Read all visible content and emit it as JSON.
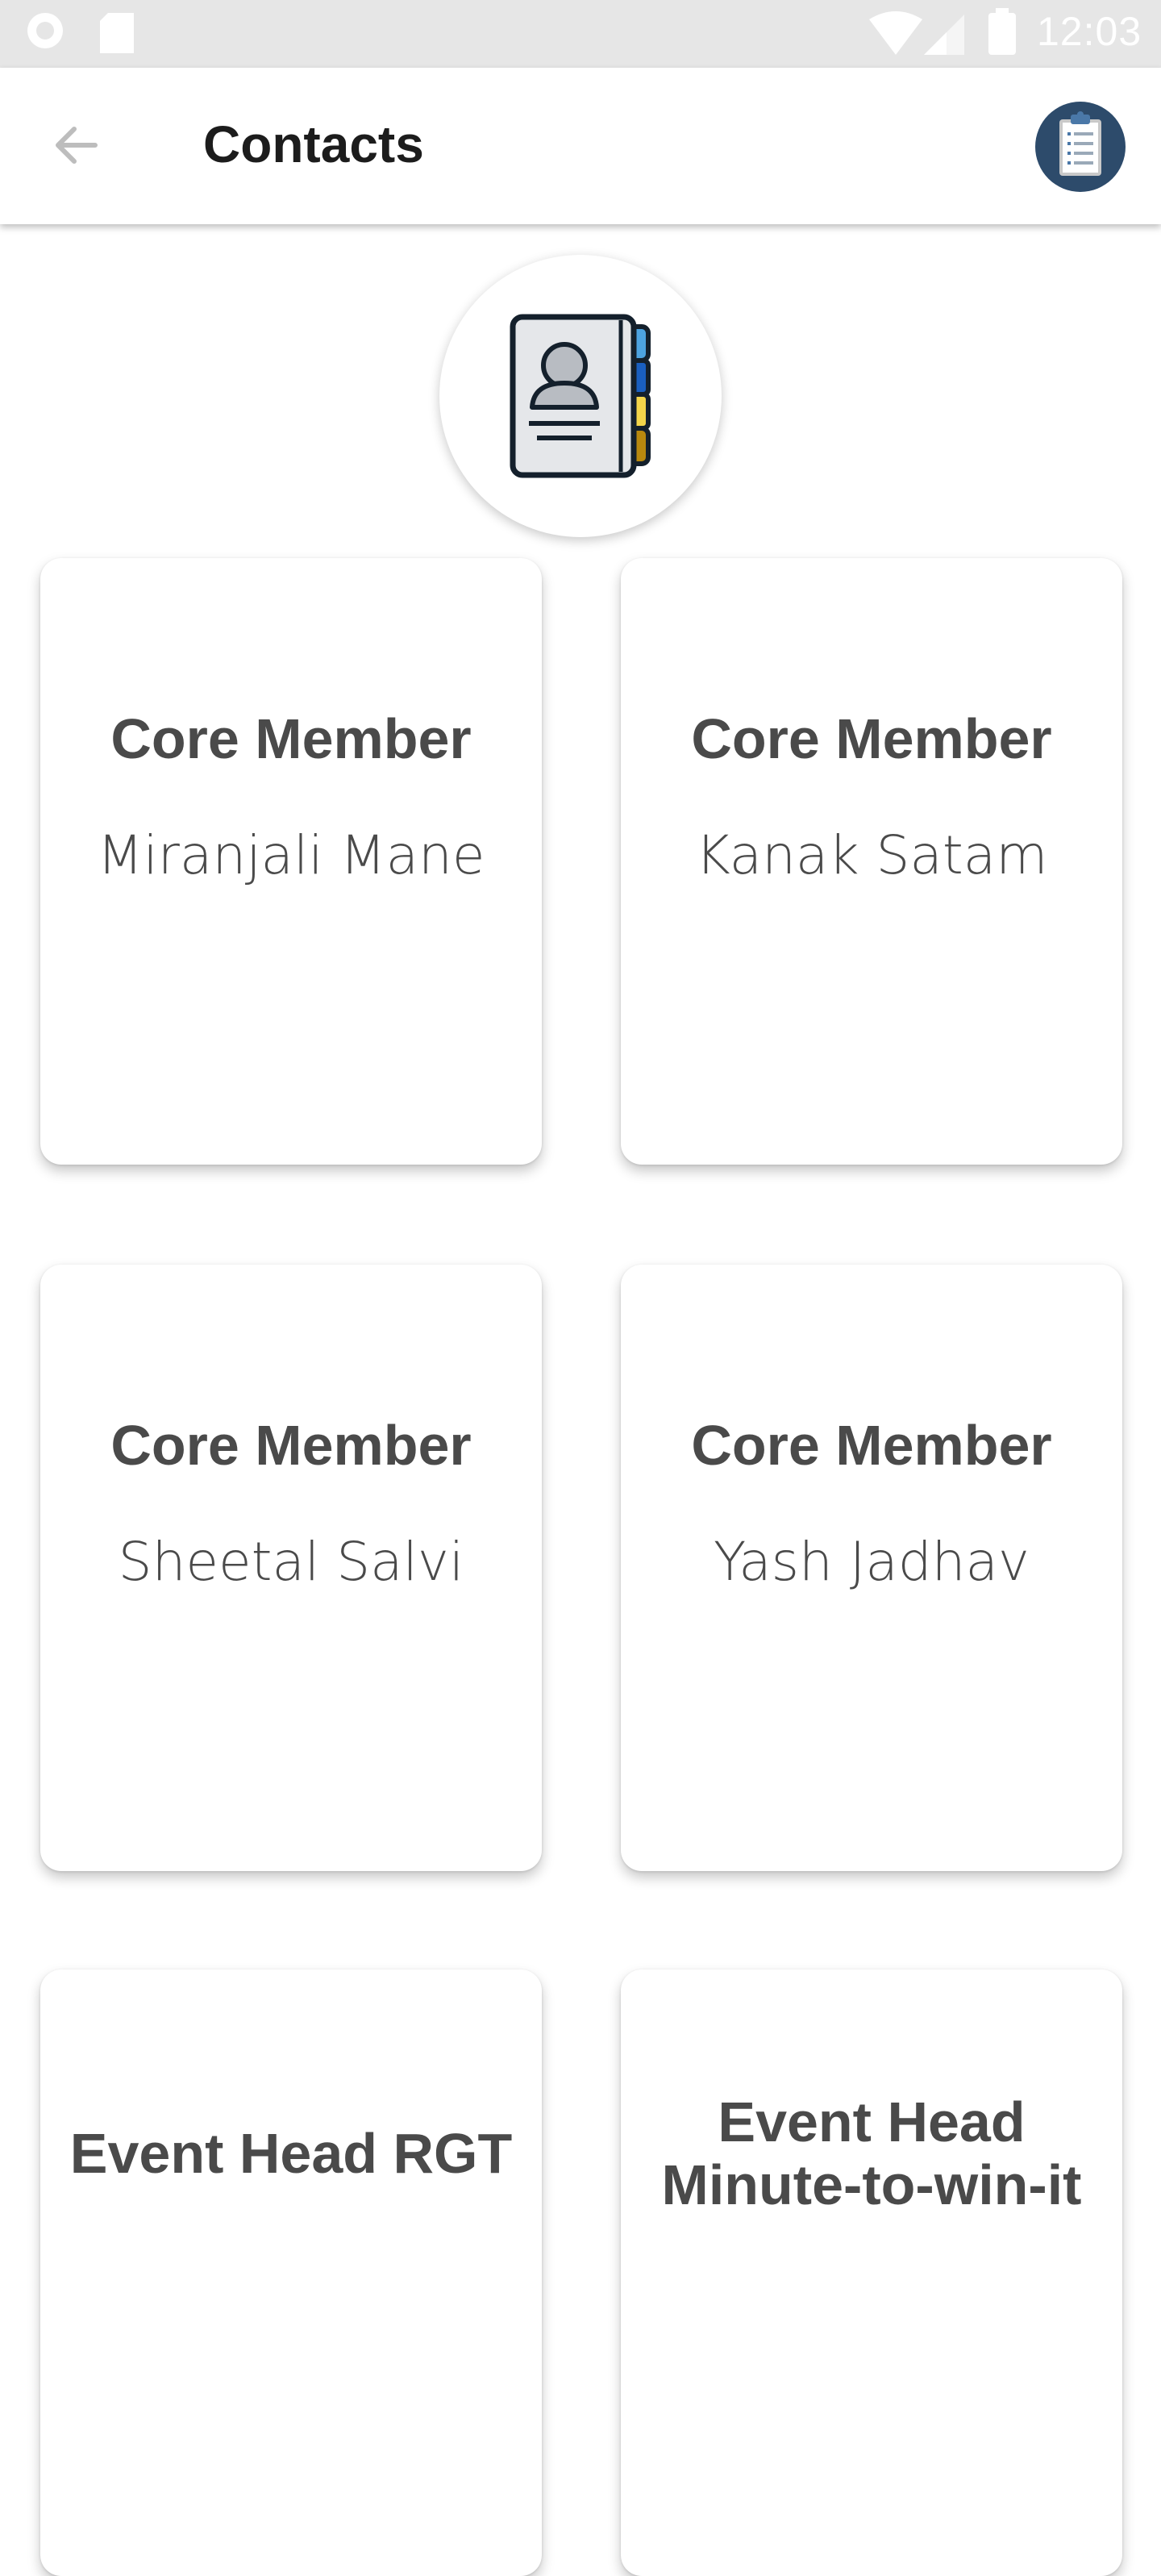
{
  "status_bar": {
    "time": "12:03"
  },
  "app_bar": {
    "title": "Contacts"
  },
  "cards": [
    {
      "role": "Core Member",
      "name": "Miranjali Mane"
    },
    {
      "role": "Core Member",
      "name": "Kanak Satam"
    },
    {
      "role": "Core Member",
      "name": "Sheetal Salvi"
    },
    {
      "role": "Core Member",
      "name": "Yash Jadhav"
    },
    {
      "role": "Event Head RGT",
      "name": ""
    },
    {
      "role": "Event Head Minute-to-win-it",
      "name": ""
    }
  ],
  "colors": {
    "accent": "#2d4b6b",
    "status_bar": "#e6e6e6"
  }
}
